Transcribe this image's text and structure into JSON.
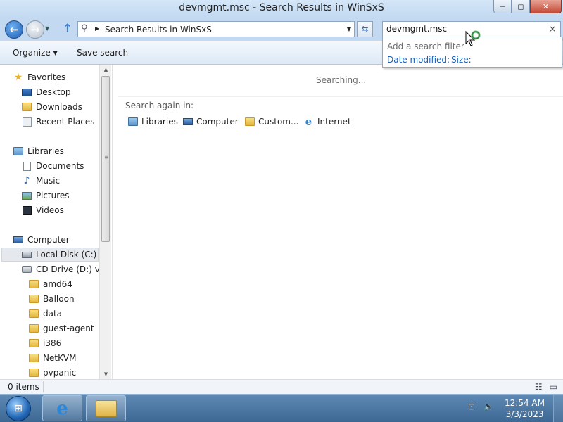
{
  "window": {
    "title": "devmgmt.msc - Search Results in WinSxS",
    "controls": {
      "minimize": "─",
      "maximize": "◻",
      "close": "✕"
    }
  },
  "nav": {
    "address_path": "Search Results in WinSxS",
    "search_value": "devmgmt.msc",
    "search_clear": "×",
    "filter_hint": "Add a search filter",
    "filters": [
      "Date modified:",
      "Size:"
    ]
  },
  "toolbar": {
    "organize_label": "Organize ▾",
    "save_search_label": "Save search"
  },
  "sidebar": {
    "favorites_header": "Favorites",
    "favorites": [
      "Desktop",
      "Downloads",
      "Recent Places"
    ],
    "libraries_header": "Libraries",
    "libraries": [
      "Documents",
      "Music",
      "Pictures",
      "Videos"
    ],
    "computer_header": "Computer",
    "drives": [
      "Local Disk (C:)",
      "CD Drive (D:) virt"
    ],
    "folders": [
      "amd64",
      "Balloon",
      "data",
      "guest-agent",
      "i386",
      "NetKVM",
      "pvpanic"
    ]
  },
  "content": {
    "status": "Searching...",
    "search_again_label": "Search again in:",
    "search_again_items": [
      "Libraries",
      "Computer",
      "Custom...",
      "Internet"
    ]
  },
  "statusbar": {
    "item_count": "0 items"
  },
  "taskbar": {
    "time": "12:54 AM",
    "date": "3/3/2023"
  },
  "icons": {
    "star": "★",
    "back": "←",
    "forward": "→",
    "up": "↑",
    "refresh": "⇆",
    "search": "🔍"
  }
}
